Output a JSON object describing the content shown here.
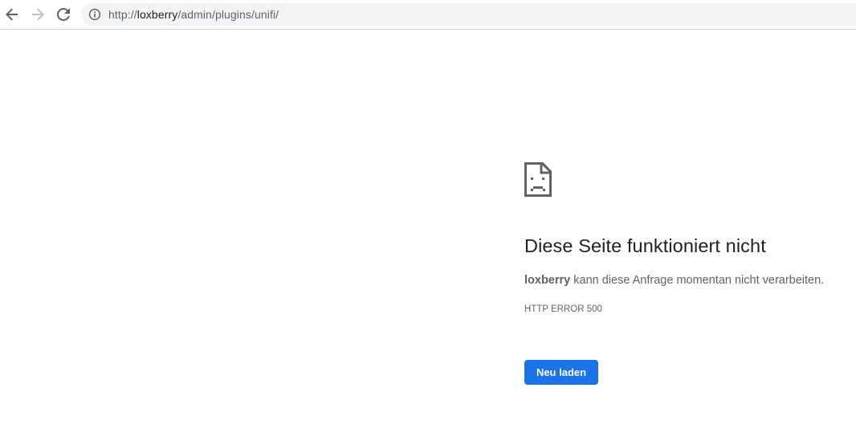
{
  "browser": {
    "url_prefix": "http://",
    "url_host": "loxberry",
    "url_path": "/admin/plugins/unifi/",
    "icons": {
      "back": "back-arrow-icon",
      "forward": "forward-arrow-icon",
      "reload": "reload-icon",
      "site_info": "info-icon"
    }
  },
  "error_page": {
    "icon": "sad-page-icon",
    "title": "Diese Seite funktioniert nicht",
    "host": "loxberry",
    "message": " kann diese Anfrage momentan nicht verarbeiten.",
    "code": "HTTP ERROR 500",
    "reload_button": "Neu laden",
    "colors": {
      "button": "#1a73e8",
      "title": "#202124",
      "text": "#5f6368"
    }
  }
}
